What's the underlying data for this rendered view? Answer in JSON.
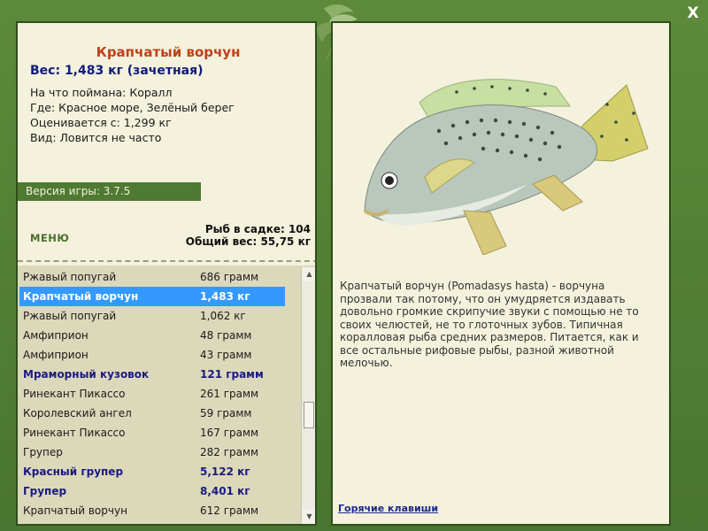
{
  "window": {
    "close_label": "X"
  },
  "fish": {
    "title": "Крапчатый ворчун",
    "weight_line": "Вес: 1,483 кг (зачетная)",
    "caught_on": "На что поймана: Коралл",
    "location": "Где: Красное море, Зелёный берег",
    "valued_from": "Оценивается с: 1,299 кг",
    "kind": "Вид: Ловится не часто",
    "description": "Крапчатый ворчун (Pomadasys hasta) - ворчуна прозвали так потому, что он умудряется издавать довольно громкие скрипучие звуки с помощью не то своих челюстей, не то глоточных зубов. Типичная коралловая рыба средних размеров. Питается, как и все остальные рифовые рыбы, разной животной мелочью."
  },
  "version": "Версия игры: 3.7.5",
  "menu_label": "МЕНЮ",
  "stats": {
    "fish_count": "Рыб в садке: 104",
    "total_weight": "Общий вес: 55,75 кг"
  },
  "list": [
    {
      "name": "Ржавый попугай",
      "weight": "686 грамм",
      "style": "normal"
    },
    {
      "name": "Крапчатый ворчун",
      "weight": "1,483 кг",
      "style": "selected"
    },
    {
      "name": "Ржавый попугай",
      "weight": "1,062 кг",
      "style": "normal"
    },
    {
      "name": "Амфиприон",
      "weight": "48 грамм",
      "style": "normal"
    },
    {
      "name": "Амфиприон",
      "weight": "43 грамм",
      "style": "normal"
    },
    {
      "name": "Мраморный кузовок",
      "weight": "121 грамм",
      "style": "bold"
    },
    {
      "name": "Ринекант Пикассо",
      "weight": "261 грамм",
      "style": "normal"
    },
    {
      "name": "Королевский ангел",
      "weight": "59 грамм",
      "style": "normal"
    },
    {
      "name": "Ринекант Пикассо",
      "weight": "167 грамм",
      "style": "normal"
    },
    {
      "name": "Групер",
      "weight": "282 грамм",
      "style": "normal"
    },
    {
      "name": "Красный групер",
      "weight": "5,122 кг",
      "style": "bold"
    },
    {
      "name": "Групер",
      "weight": "8,401 кг",
      "style": "bold"
    },
    {
      "name": "Крапчатый ворчун",
      "weight": "612 грамм",
      "style": "normal"
    }
  ],
  "hotkeys_label": "Горячие клавиши",
  "icons": {
    "close": "close-icon",
    "logo": "leaf-logo-icon",
    "fish": "fish-illustration",
    "scroll_up": "scroll-up-icon",
    "scroll_down": "scroll-down-icon"
  },
  "colors": {
    "frame": "#4f7a32",
    "panel": "#f4f1dc",
    "title": "#c0401a",
    "weight": "#101a7a",
    "selected": "#3399ff",
    "link": "#1a2a8a"
  }
}
